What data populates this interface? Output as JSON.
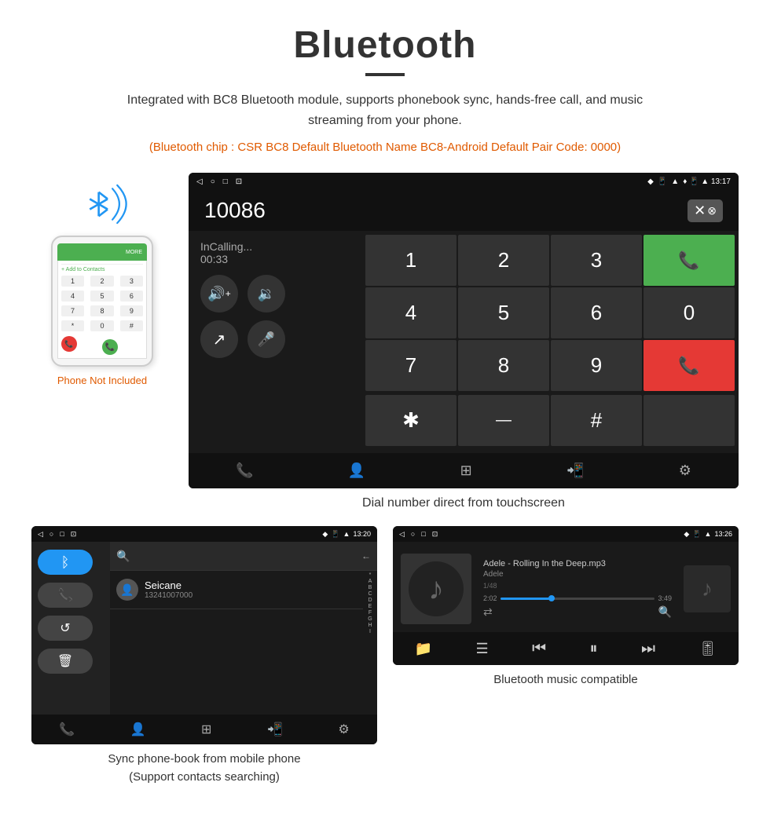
{
  "header": {
    "title": "Bluetooth",
    "divider": true,
    "description": "Integrated with BC8 Bluetooth module, supports phonebook sync, hands-free call, and music streaming from your phone.",
    "note": "(Bluetooth chip : CSR BC8    Default Bluetooth Name BC8-Android    Default Pair Code: 0000)"
  },
  "dialer_screen": {
    "status_bar": {
      "left_icons": [
        "◁",
        "○",
        "□",
        "⊡"
      ],
      "right_icons": "♦ 📱 ▲ 13:17"
    },
    "number": "10086",
    "call_status": "InCalling...",
    "call_duration": "00:33",
    "keys": [
      "1",
      "2",
      "3",
      "4",
      "5",
      "6",
      "7",
      "8",
      "9"
    ],
    "special_keys": [
      "*",
      "0",
      "#"
    ],
    "caption": "Dial number direct from touchscreen"
  },
  "phonebook_screen": {
    "status_bar_right": "♦ 📱 ▲ 13:20",
    "contact_name": "Seicane",
    "contact_number": "13241007000",
    "alphabet": [
      "*",
      "A",
      "B",
      "C",
      "D",
      "E",
      "F",
      "G",
      "H",
      "I"
    ],
    "caption": "Sync phone-book from mobile phone\n(Support contacts searching)"
  },
  "music_screen": {
    "status_bar_right": "♦ 📱 ▲ 13:26",
    "track_name": "Adele - Rolling In the Deep.mp3",
    "artist": "Adele",
    "track_count": "1/48",
    "time_current": "2:02",
    "time_total": "3:49",
    "progress_percent": 33,
    "caption": "Bluetooth music compatible"
  },
  "phone_illustration": {
    "not_included_text": "Phone Not Included"
  },
  "icons": {
    "bluetooth": "ᛒ",
    "phone": "📞",
    "person": "👤",
    "grid": "⊞",
    "gear": "⚙",
    "music_note": "♪",
    "search": "🔍",
    "shuffle": "⇄",
    "prev": "⏮",
    "play": "⏸",
    "next": "⏭",
    "equalizer": "🎚",
    "folder": "📁",
    "list": "☰",
    "volume_up": "🔊",
    "volume_down": "🔉",
    "mic": "🎤",
    "transfer": "↗",
    "delete": "⌫",
    "call_green": "📞",
    "call_red": "📞"
  }
}
